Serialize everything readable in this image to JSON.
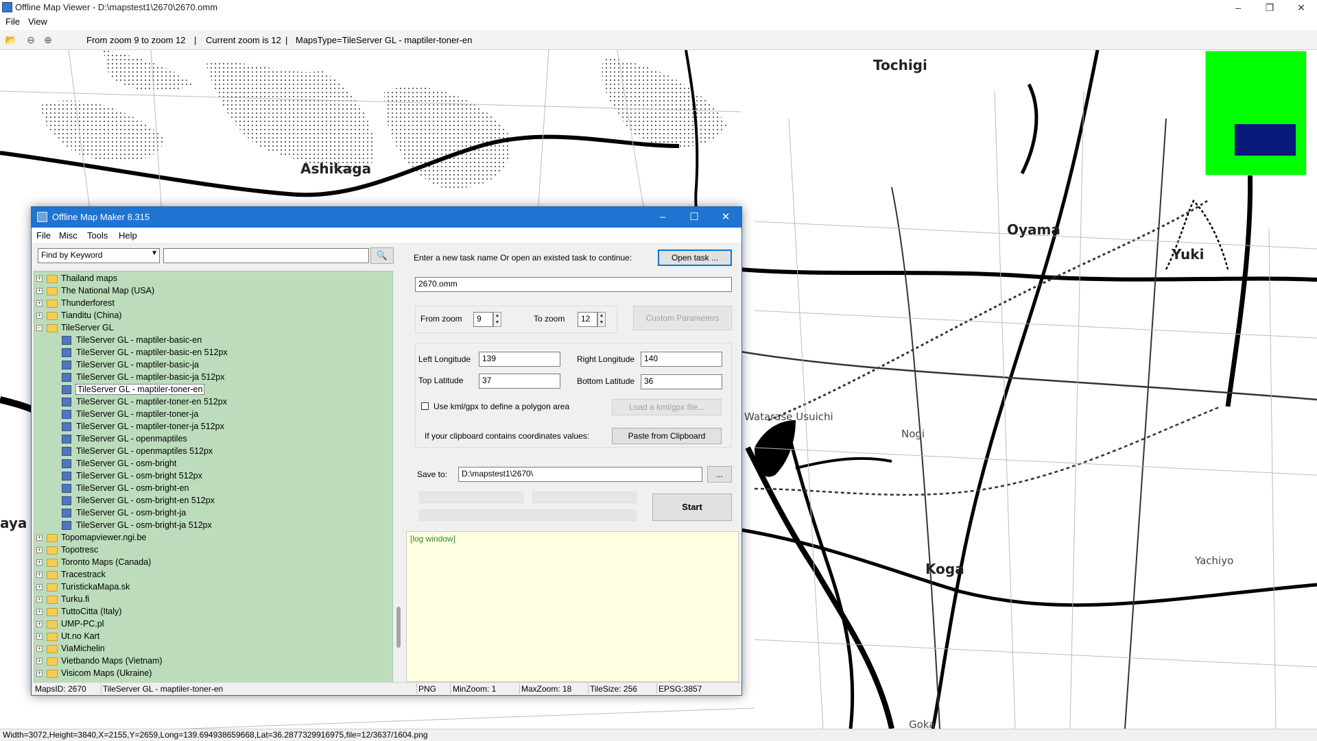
{
  "viewer": {
    "title": "Offline Map Viewer - D:\\mapstest1\\2670\\2670.omm",
    "menu": [
      "File",
      "View"
    ],
    "toolbar": {
      "zoom_range": "From zoom 9 to zoom 12",
      "current_zoom": "Current zoom is 12",
      "maps_type": "MapsType=TileServer GL - maptiler-toner-en",
      "sep": "|"
    },
    "status": "Width=3072,Height=3840,X=2155,Y=2659,Long=139.694938659668,Lat=36.2877329916975,file=12/3637/1604.png",
    "map_labels": {
      "tochigi": "Tochigi",
      "ashikaga": "Ashikaga",
      "oyama": "Oyama",
      "yuki": "Yuki",
      "watarase": "Watarase Usuichi",
      "nogi": "Nogi",
      "koga": "Koga",
      "yachiyo": "Yachiyo",
      "aya": "aya",
      "goka": "Goka"
    },
    "overview_color": "#00ff00",
    "overview_view_color": "#0a1a7a"
  },
  "dialog": {
    "title": "Offline Map Maker 8.315",
    "menu": [
      "File",
      "Misc",
      "Tools",
      "Help"
    ],
    "search": {
      "mode": "Find by Keyword",
      "value": ""
    },
    "task_prompt": "Enter a new task name Or open an existed task to continue:",
    "open_task": "Open task ...",
    "task_name": "2670.omm",
    "from_zoom_label": "From zoom",
    "from_zoom": "9",
    "to_zoom_label": "To zoom",
    "to_zoom": "12",
    "custom_params": "Custom Parameters",
    "left_lon_label": "Left Longitude",
    "left_lon": "139",
    "right_lon_label": "Right Longitude",
    "right_lon": "140",
    "top_lat_label": "Top Latitude",
    "top_lat": "37",
    "bottom_lat_label": "Bottom Latitude",
    "bottom_lat": "36",
    "kml_label": "Use kml/gpx to define a polygon area",
    "load_kml": "Load a kml/gpx file...",
    "clipboard_label": "If your clipboard contains coordinates values:",
    "paste_clipboard": "Paste from Clipboard",
    "save_to_label": "Save to:",
    "save_to": "D:\\mapstest1\\2670\\",
    "browse": "...",
    "start": "Start",
    "log": "[log window]",
    "tree": [
      {
        "label": "Thailand maps",
        "type": "folder"
      },
      {
        "label": "The National Map (USA)",
        "type": "folder"
      },
      {
        "label": "Thunderforest",
        "type": "folder"
      },
      {
        "label": "Tianditu (China)",
        "type": "folder"
      },
      {
        "label": "TileServer GL",
        "type": "folder-open"
      },
      {
        "label": "TileServer GL - maptiler-basic-en",
        "type": "map"
      },
      {
        "label": "TileServer GL - maptiler-basic-en 512px",
        "type": "map"
      },
      {
        "label": "TileServer GL - maptiler-basic-ja",
        "type": "map"
      },
      {
        "label": "TileServer GL - maptiler-basic-ja 512px",
        "type": "map"
      },
      {
        "label": "TileServer GL - maptiler-toner-en",
        "type": "map",
        "selected": true
      },
      {
        "label": "TileServer GL - maptiler-toner-en 512px",
        "type": "map"
      },
      {
        "label": "TileServer GL - maptiler-toner-ja",
        "type": "map"
      },
      {
        "label": "TileServer GL - maptiler-toner-ja 512px",
        "type": "map"
      },
      {
        "label": "TileServer GL - openmaptiles",
        "type": "map"
      },
      {
        "label": "TileServer GL - openmaptiles 512px",
        "type": "map"
      },
      {
        "label": "TileServer GL - osm-bright",
        "type": "map"
      },
      {
        "label": "TileServer GL - osm-bright 512px",
        "type": "map"
      },
      {
        "label": "TileServer GL - osm-bright-en",
        "type": "map"
      },
      {
        "label": "TileServer GL - osm-bright-en 512px",
        "type": "map"
      },
      {
        "label": "TileServer GL - osm-bright-ja",
        "type": "map"
      },
      {
        "label": "TileServer GL - osm-bright-ja 512px",
        "type": "map"
      },
      {
        "label": "Topomapviewer.ngi.be",
        "type": "folder"
      },
      {
        "label": "Topotresc",
        "type": "folder"
      },
      {
        "label": "Toronto Maps (Canada)",
        "type": "folder"
      },
      {
        "label": "Tracestrack",
        "type": "folder"
      },
      {
        "label": "TuristickaMapa.sk",
        "type": "folder"
      },
      {
        "label": "Turku.fi",
        "type": "folder"
      },
      {
        "label": "TuttoCitta (Italy)",
        "type": "folder"
      },
      {
        "label": "UMP-PC.pl",
        "type": "folder"
      },
      {
        "label": "Ut.no Kart",
        "type": "folder"
      },
      {
        "label": "ViaMichelin",
        "type": "folder"
      },
      {
        "label": "Vietbando Maps (Vietnam)",
        "type": "folder"
      },
      {
        "label": "Visicom Maps (Ukraine)",
        "type": "folder"
      }
    ],
    "status": {
      "maps_id": "MapsID: 2670",
      "map_name": "TileServer GL - maptiler-toner-en",
      "format": "PNG",
      "min_zoom": "MinZoom: 1",
      "max_zoom": "MaxZoom: 18",
      "tile_size": "TileSize: 256",
      "epsg": "EPSG:3857"
    }
  }
}
